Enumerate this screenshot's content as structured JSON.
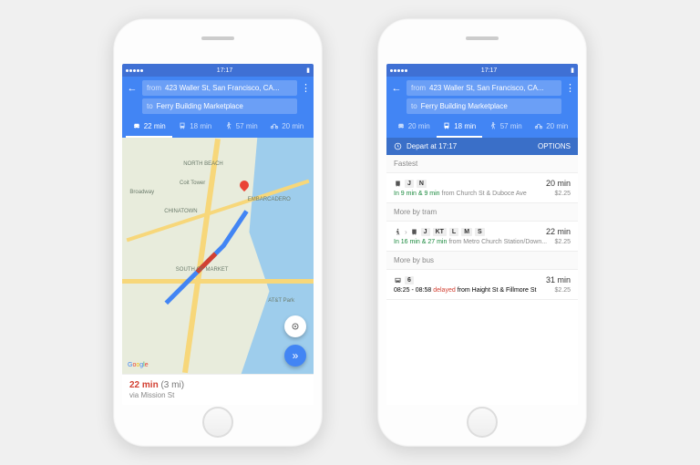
{
  "status": {
    "time": "17:17",
    "carrier": "•••••"
  },
  "header": {
    "from_label": "from",
    "from_value": "423 Waller St, San Francisco, CA...",
    "to_label": "to",
    "to_value": "Ferry Building Marketplace"
  },
  "tabs": {
    "car": "22 min",
    "transit": "18 min",
    "walk": "57 min",
    "bike": "20 min"
  },
  "left": {
    "active_tab": "car",
    "map": {
      "labels": [
        "NORTH BEACH",
        "Coit Tower",
        "CHINATOWN",
        "EMBARCADERO",
        "SOUTH OF MARKET",
        "AT&T Park",
        "Broadway"
      ],
      "attribution": "Google"
    },
    "footer": {
      "time": "22 min",
      "distance": "(3 mi)",
      "via": "via Mission St"
    }
  },
  "right": {
    "active_tab": "transit",
    "tabs": {
      "car": "20 min",
      "transit": "18 min",
      "walk": "57 min",
      "bike": "20 min"
    },
    "subbar": {
      "depart": "Depart at 17:17",
      "options": "OPTIONS"
    },
    "sections": [
      {
        "title": "Fastest",
        "items": [
          {
            "mode": "tram",
            "lines": [
              "J",
              "N"
            ],
            "duration": "20 min",
            "depart_bold": "In 9 min & 9 min",
            "depart_from": "from Church St & Duboce Ave",
            "price": "$2.25"
          }
        ]
      },
      {
        "title": "More by tram",
        "items": [
          {
            "mode": "walk-tram",
            "lines": [
              "J",
              "KT",
              "L",
              "M",
              "S"
            ],
            "duration": "22 min",
            "depart_bold": "In 16 min & 27 min",
            "depart_from": "from Metro Church Station/Down...",
            "price": "$2.25"
          }
        ]
      },
      {
        "title": "More by bus",
        "items": [
          {
            "mode": "bus",
            "lines": [
              "6"
            ],
            "duration": "31 min",
            "time_range": "08:25 - 08:58",
            "delayed": "delayed",
            "depart_from": "from Haight St & Fillmore St",
            "price": "$2.25"
          }
        ]
      }
    ]
  }
}
